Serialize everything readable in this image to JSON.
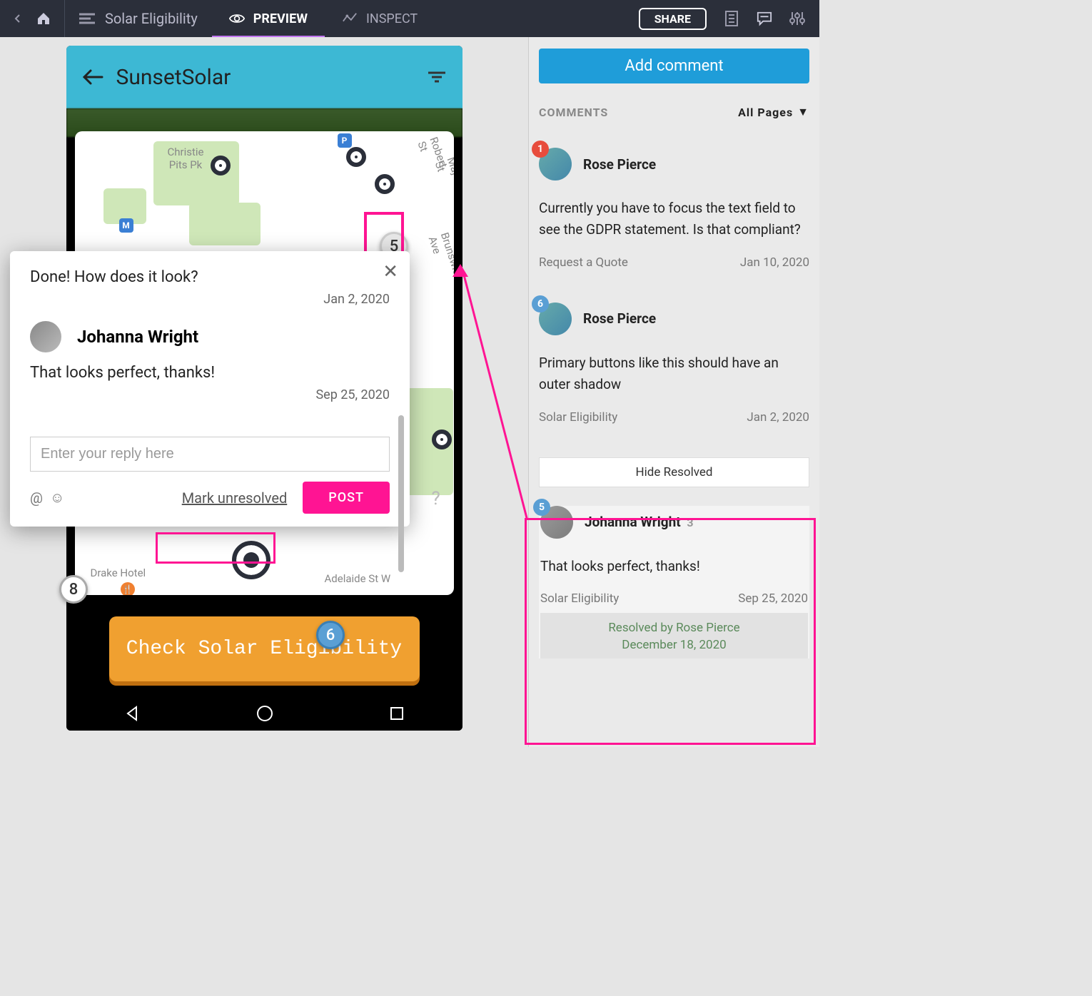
{
  "toolbar": {
    "project_name": "Solar Eligibility",
    "tab_preview": "PREVIEW",
    "tab_inspect": "INSPECT",
    "share": "SHARE"
  },
  "app": {
    "title": "SunsetSolar",
    "cta": "Check Solar Eligibility"
  },
  "map_labels": {
    "christie": "Christie\nPits Pk",
    "robert": "Robert St",
    "major": "Major St",
    "brunswick": "Brunswick Ave",
    "drake": "Drake Hotel",
    "adelaide": "Adelaide St W"
  },
  "thread": {
    "msg1": "Done! How does it look?",
    "date1": "Jan 2, 2020",
    "author": "Johanna Wright",
    "msg2": "That looks perfect, thanks!",
    "date2": "Sep 25, 2020",
    "reply_placeholder": "Enter your reply here",
    "mark_unresolved": "Mark unresolved",
    "post": "POST"
  },
  "map_badges": {
    "five": "5",
    "eight": "8",
    "six": "6"
  },
  "panel": {
    "add_comment": "Add comment",
    "header": "COMMENTS",
    "filter": "All Pages",
    "hide_resolved": "Hide Resolved"
  },
  "comments": {
    "c1": {
      "badge": "1",
      "author": "Rose Pierce",
      "text": "Currently you have to focus the text field to see the GDPR statement. Is that compliant?",
      "location": "Request a Quote",
      "date": "Jan 10, 2020"
    },
    "c2": {
      "badge": "6",
      "author": "Rose Pierce",
      "text": "Primary buttons like this should have an outer shadow",
      "location": "Solar Eligibility",
      "date": "Jan 2, 2020"
    },
    "c3": {
      "badge": "5",
      "author": "Johanna Wright",
      "count": "3",
      "text": "That looks perfect, thanks!",
      "location": "Solar Eligibility",
      "date": "Sep 25, 2020",
      "resolved_by": "Resolved by Rose Pierce",
      "resolved_date": "December 18, 2020"
    }
  }
}
